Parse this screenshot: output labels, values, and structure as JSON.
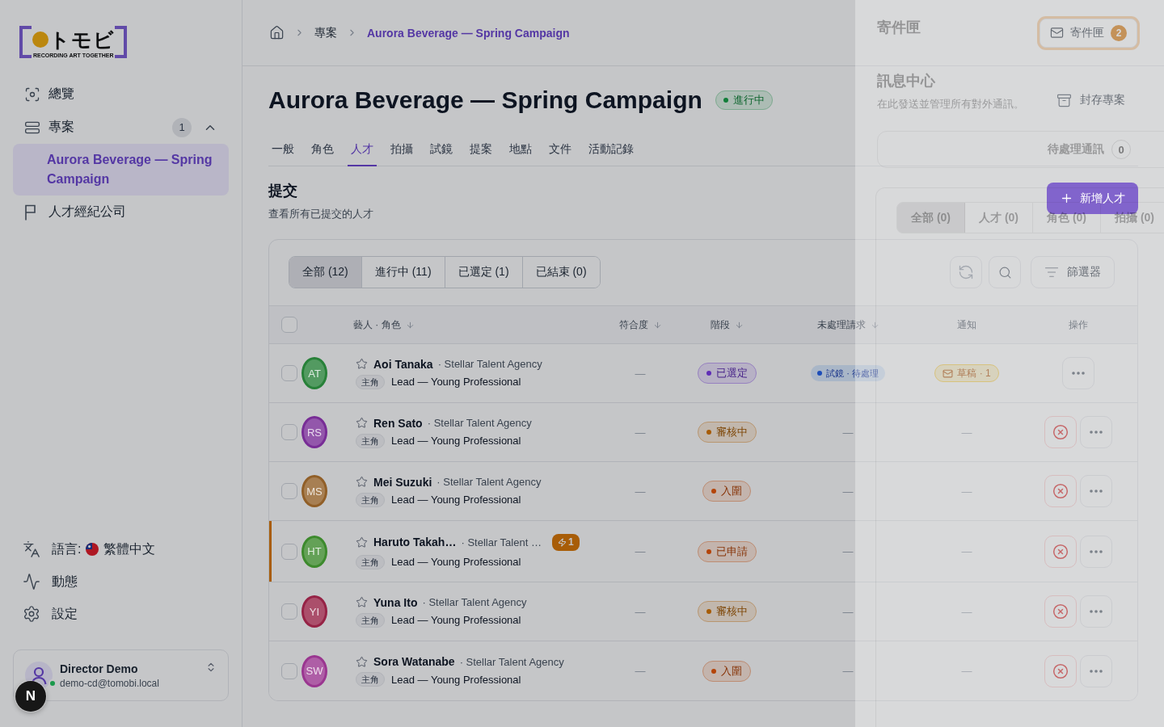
{
  "sidebar": {
    "logo": {
      "mark": "トモビ",
      "tagline": "RECORDING ART TOGETHER"
    },
    "nav": [
      {
        "kind": "overview",
        "label": "總覽",
        "selected": false
      },
      {
        "kind": "projects",
        "label": "專案",
        "selected": false,
        "count": "1",
        "expanded": true,
        "children": [
          {
            "label": "Aurora Beverage — Spring Campaign",
            "selected": true
          }
        ]
      },
      {
        "kind": "agencies",
        "label": "人才經紀公司",
        "selected": false
      }
    ],
    "footer_nav": [
      {
        "kind": "language",
        "label": "語言:",
        "value": "繁體中文"
      },
      {
        "kind": "activity",
        "label": "動態"
      },
      {
        "kind": "settings",
        "label": "設定"
      }
    ],
    "user": {
      "name": "Director Demo",
      "email": "demo-cd@tomobi.local",
      "online": true
    }
  },
  "dev_button": {
    "label": "N"
  },
  "header": {
    "breadcrumb": [
      {
        "kind": "home",
        "current": false
      },
      {
        "kind": "link",
        "label": "專案",
        "current": false
      },
      {
        "kind": "link",
        "label": "Aurora Beverage — Spring Campaign",
        "current": true
      }
    ],
    "inbox_button": {
      "label": "寄件匣",
      "count": "2",
      "active": true
    }
  },
  "project": {
    "title": "Aurora Beverage — Spring Campaign",
    "status": {
      "label": "進行中",
      "color": "#117e39"
    },
    "archive_button": "封存專案",
    "tabs": [
      {
        "label": "一般",
        "selected": false
      },
      {
        "label": "角色",
        "selected": false
      },
      {
        "label": "人才",
        "selected": true
      },
      {
        "label": "拍攝",
        "selected": false
      },
      {
        "label": "試鏡",
        "selected": false
      },
      {
        "label": "提案",
        "selected": false
      },
      {
        "label": "地點",
        "selected": false
      },
      {
        "label": "文件",
        "selected": false
      },
      {
        "label": "活動記錄",
        "selected": false
      }
    ]
  },
  "submissions": {
    "title": "提交",
    "description": "查看所有已提交的人才",
    "add_button": "新增人才",
    "filters": [
      {
        "label": "全部 (12)",
        "selected": true
      },
      {
        "label": "進行中 (11)",
        "selected": false
      },
      {
        "label": "已選定 (1)",
        "selected": false
      },
      {
        "label": "已結束 (0)",
        "selected": false
      }
    ],
    "filter_button": "篩選器",
    "select_all_checked": false,
    "columns": [
      {
        "label": "藝人 · 角色",
        "sortable": true
      },
      {
        "label": "符合度",
        "sortable": true
      },
      {
        "label": "階段",
        "sortable": true
      },
      {
        "label": "未處理請求",
        "sortable": true
      },
      {
        "label": "通知",
        "sortable": false
      },
      {
        "label": "操作",
        "sortable": false
      }
    ],
    "rows": [
      {
        "checked": false,
        "highlighted": false,
        "initials": "AT",
        "color": "#288139",
        "starred": false,
        "name": "Aoi Tanaka",
        "agency": "· Stellar Talent Agency",
        "role_tag": "主角",
        "role": "Lead — Young Professional",
        "fit": "—",
        "stage": {
          "label": "已選定",
          "color": "#5f2db6"
        },
        "request": {
          "kind": "pending",
          "label": "試鏡 · 待處理"
        },
        "notice": {
          "kind": "draft",
          "label": "草稿 · 1"
        },
        "rejectable": false
      },
      {
        "checked": false,
        "highlighted": false,
        "initials": "RS",
        "color": "#782d96",
        "starred": false,
        "name": "Ren Sato",
        "agency": "· Stellar Talent Agency",
        "role_tag": "主角",
        "role": "Lead — Young Professional",
        "fit": "—",
        "stage": {
          "label": "審核中",
          "color": "#a75c05"
        },
        "request": {
          "kind": "none",
          "label": "—"
        },
        "notice": {
          "kind": "none",
          "label": "—"
        },
        "rejectable": true
      },
      {
        "checked": false,
        "highlighted": false,
        "initials": "MS",
        "color": "#915f28",
        "starred": false,
        "name": "Mei Suzuki",
        "agency": "· Stellar Talent Agency",
        "role_tag": "主角",
        "role": "Lead — Young Professional",
        "fit": "—",
        "stage": {
          "label": "入圍",
          "color": "#b44409"
        },
        "request": {
          "kind": "none",
          "label": "—"
        },
        "notice": {
          "kind": "none",
          "label": "—"
        },
        "rejectable": true
      },
      {
        "checked": false,
        "highlighted": true,
        "initials": "HT",
        "color": "#3d8a2d",
        "starred": false,
        "name": "Haruto Takah…",
        "agency": "· Stellar Talent …",
        "alert": "1",
        "role_tag": "主角",
        "role": "Lead — Young Professional",
        "fit": "—",
        "stage": {
          "label": "已申請",
          "color": "#b44409"
        },
        "request": {
          "kind": "none",
          "label": "—"
        },
        "notice": {
          "kind": "none",
          "label": "—"
        },
        "rejectable": true
      },
      {
        "checked": false,
        "highlighted": false,
        "initials": "YI",
        "color": "#962346",
        "starred": false,
        "name": "Yuna Ito",
        "agency": "· Stellar Talent Agency",
        "role_tag": "主角",
        "role": "Lead — Young Professional",
        "fit": "—",
        "stage": {
          "label": "審核中",
          "color": "#a75c05"
        },
        "request": {
          "kind": "none",
          "label": "—"
        },
        "notice": {
          "kind": "none",
          "label": "—"
        },
        "rejectable": true
      },
      {
        "checked": false,
        "highlighted": false,
        "initials": "SW",
        "color": "#9a3690",
        "starred": false,
        "name": "Sora Watanabe",
        "agency": "· Stellar Talent Agency",
        "role_tag": "主角",
        "role": "Lead — Young Professional",
        "fit": "—",
        "stage": {
          "label": "入圍",
          "color": "#b44409"
        },
        "request": {
          "kind": "none",
          "label": "—"
        },
        "notice": {
          "kind": "none",
          "label": "—"
        },
        "rejectable": true
      }
    ]
  },
  "message_panel": {
    "title": "寄件匣",
    "heading": "訊息中心",
    "description": "在此發送並管理所有對外通訊。",
    "pending": {
      "label": "待處理通訊",
      "count": "0"
    },
    "tabs": [
      {
        "label": "全部 (0)",
        "selected": true
      },
      {
        "label": "人才 (0)",
        "selected": false
      },
      {
        "label": "角色 (0)",
        "selected": false
      },
      {
        "label": "拍攝 (0)",
        "selected": false
      }
    ]
  }
}
